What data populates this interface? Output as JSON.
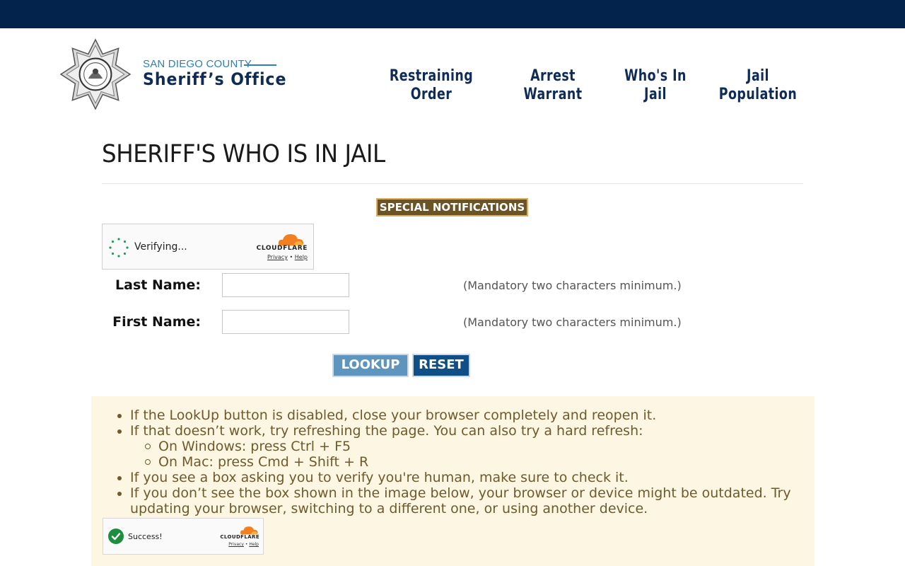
{
  "header": {
    "county": "SAN DIEGO COUNTY",
    "office": "Sheriff’s Office",
    "nav": [
      {
        "line1": "Restraining",
        "line2": "Order"
      },
      {
        "line1": "Arrest",
        "line2": "Warrant"
      },
      {
        "line1": "Who's In",
        "line2": "Jail"
      },
      {
        "line1": "Jail",
        "line2": "Population"
      }
    ]
  },
  "page": {
    "title": "SHERIFF'S WHO IS IN JAIL",
    "special_notifications": "SPECIAL NOTIFICATIONS"
  },
  "captcha": {
    "status": "Verifying...",
    "brand": "CLOUDFLARE",
    "privacy": "Privacy",
    "separator": "•",
    "help": "Help"
  },
  "form": {
    "last_name_label": "Last Name:",
    "first_name_label": "First Name:",
    "last_name_value": "",
    "first_name_value": "",
    "hint": "(Mandatory two characters minimum.)",
    "lookup_label": "LOOKUP",
    "reset_label": "RESET"
  },
  "info": {
    "items": [
      "If the LookUp button is disabled, close your browser completely and reopen it.",
      "If that doesn’t work, try refreshing the page. You can also try a hard refresh:",
      "If you see a box asking you to verify you're human, make sure to check it.",
      "If you don’t see the box shown in the image below, your browser or device might be outdated. Try updating your browser, switching to a different one, or using another device."
    ],
    "subitems": [
      "On Windows: press Ctrl + F5",
      "On Mac: press Cmd + Shift + R"
    ],
    "example_status": "Success!",
    "example_brand": "CLOUDFLARE",
    "example_privacy": "Privacy",
    "example_separator": "•",
    "example_help": "Help"
  },
  "colors": {
    "topbar": "#03224c",
    "brand_navy": "#0f2c59",
    "special_bg": "#6b5328",
    "lookup_bg": "#5d95be",
    "reset_bg": "#0f4e86",
    "info_bg": "#fcf6e2",
    "cloudflare_orange": "#f38020"
  }
}
